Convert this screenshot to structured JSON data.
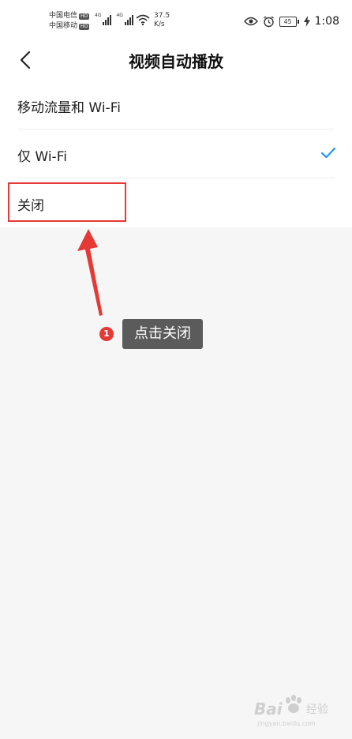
{
  "status_bar": {
    "carrier1": "中国电信",
    "carrier2": "中国移动",
    "hd": "HD",
    "network_gen": "4G",
    "speed_value": "37.5",
    "speed_unit": "K/s",
    "battery": "45",
    "time": "1:08"
  },
  "header": {
    "title": "视频自动播放"
  },
  "options": [
    {
      "label": "移动流量和 Wi-Fi",
      "selected": false
    },
    {
      "label": "仅 Wi-Fi",
      "selected": true
    },
    {
      "label": "关闭",
      "selected": false
    }
  ],
  "annotation": {
    "step": "1",
    "text": "点击关闭",
    "color": "#e53935"
  },
  "watermark": {
    "text": "Bai",
    "text_cn": "经验",
    "url": "jingyan.baidu.com"
  },
  "colors": {
    "accent": "#2196f3",
    "highlight": "#e53935"
  }
}
